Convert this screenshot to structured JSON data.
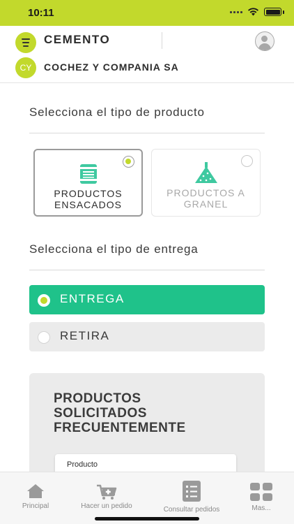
{
  "status_bar": {
    "time": "10:11"
  },
  "header": {
    "title": "CEMENTO",
    "company_initials": "CY",
    "company_name": "COCHEZ Y COMPANIA SA"
  },
  "product_type": {
    "title": "Selecciona el tipo de producto",
    "options": [
      {
        "label_line1": "PRODUCTOS",
        "label_line2": "ENSACADOS",
        "selected": true
      },
      {
        "label_line1": "PRODUCTOS A",
        "label_line2": "GRANEL",
        "selected": false
      }
    ]
  },
  "delivery_type": {
    "title": "Selecciona el tipo de entrega",
    "options": [
      {
        "label": "ENTREGA",
        "selected": true
      },
      {
        "label": "RETIRA",
        "selected": false
      }
    ]
  },
  "frequent_products": {
    "title_line1": "PRODUCTOS",
    "title_line2": "SOLICITADOS",
    "title_line3": "FRECUENTEMENTE",
    "card_label": "Producto"
  },
  "tab_bar": {
    "tabs": [
      {
        "label": "Principal",
        "icon": "home-icon"
      },
      {
        "label": "Hacer un pedido",
        "icon": "cart-add-icon"
      },
      {
        "label": "Consultar pedidos",
        "icon": "orders-list-icon"
      },
      {
        "label": "Mas...",
        "icon": "grid-icon"
      }
    ]
  },
  "colors": {
    "brand_lime": "#c2d92c",
    "accent_green": "#1fc28a",
    "teal_icon": "#3fc9a0"
  }
}
